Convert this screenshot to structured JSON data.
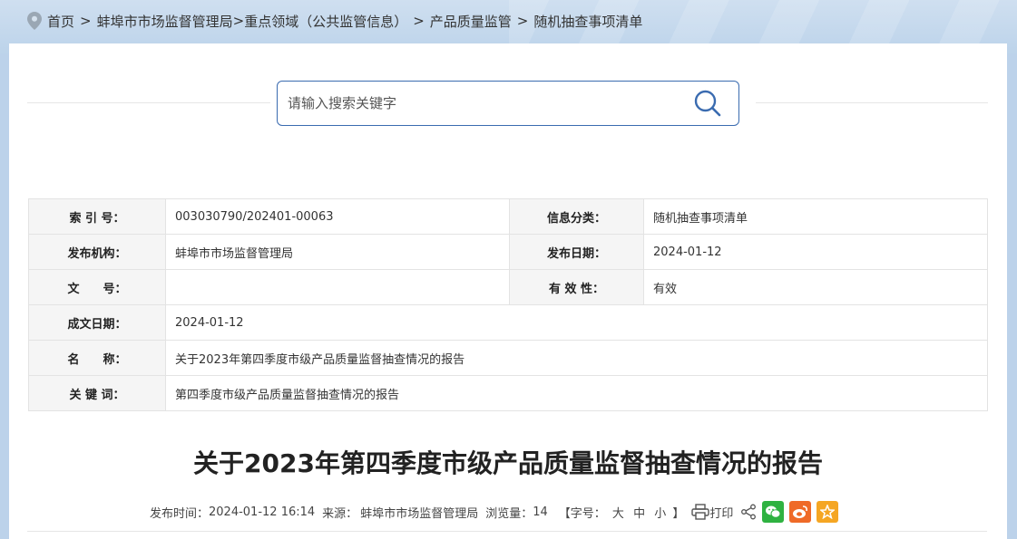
{
  "breadcrumb": {
    "items": [
      "首页",
      "蚌埠市市场监督管理局",
      "重点领域（公共监管信息）",
      "产品质量监管",
      "随机抽查事项清单"
    ],
    "separator": ">"
  },
  "search": {
    "placeholder": "请输入搜索关键字"
  },
  "meta": {
    "index_label": "索 引 号：",
    "index_value": "003030790/202401-00063",
    "category_label": "信息分类：",
    "category_value": "随机抽查事项清单",
    "publisher_label": "发布机构：",
    "publisher_value": "蚌埠市市场监督管理局",
    "pubdate_label": "发布日期：",
    "pubdate_value": "2024-01-12",
    "docno_label": "文　　号：",
    "docno_value": "",
    "validity_label": "有 效 性：",
    "validity_value": "有效",
    "created_label": "成文日期：",
    "created_value": "2024-01-12",
    "name_label": "名　　称：",
    "name_value": "关于2023年第四季度市级产品质量监督抽查情况的报告",
    "keywords_label": "关 键 词：",
    "keywords_value": "第四季度市级产品质量监督抽查情况的报告"
  },
  "article": {
    "title": "关于2023年第四季度市级产品质量监督抽查情况的报告",
    "publish_time_label": "发布时间：",
    "publish_time": "2024-01-12 16:14",
    "source_label": "来源：",
    "source": "蚌埠市市场监督管理局",
    "views_label": "浏览量：",
    "views": "14",
    "font_size_label": "【字号：",
    "font_large": "大",
    "font_medium": "中",
    "font_small": "小",
    "font_size_close": "】",
    "print_label": "打印"
  },
  "colors": {
    "accent": "#3a6bb0",
    "wechat": "#2fb241",
    "weibo": "#ef6a28",
    "favorite": "#f5a623"
  },
  "icons": [
    "location-pin-icon",
    "search-icon",
    "print-icon",
    "share-icon",
    "wechat-icon",
    "weibo-icon",
    "star-icon"
  ]
}
